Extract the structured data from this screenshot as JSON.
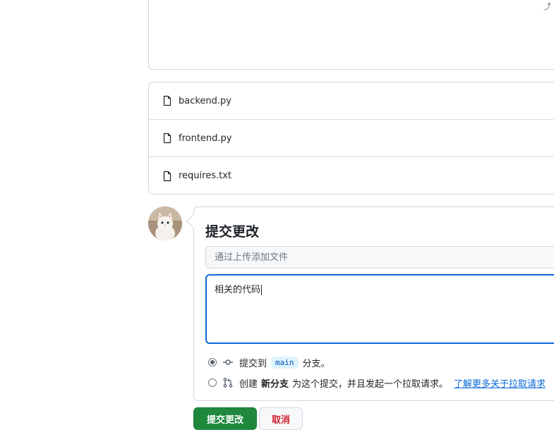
{
  "dropzone": {
    "corner_mark": "⤴"
  },
  "files": [
    {
      "name": "backend.py"
    },
    {
      "name": "frontend.py"
    },
    {
      "name": "requires.txt"
    }
  ],
  "commit": {
    "title": "提交更改",
    "summary_placeholder": "通过上传添加文件",
    "summary_value": "",
    "description": "相关的代码",
    "option_direct": {
      "prefix": "提交到",
      "branch": "main",
      "suffix": "分支。",
      "selected": true
    },
    "option_new_branch": {
      "prefix": "创建",
      "bold": "新分支",
      "suffix": "为这个提交，并且发起一个拉取请求。",
      "link": "了解更多关于拉取请求",
      "selected": false
    }
  },
  "buttons": {
    "commit": "提交更改",
    "cancel": "取消"
  },
  "colors": {
    "primary_button": "#1f883d",
    "cancel_text": "#cf222e",
    "focus_border": "#0969da",
    "link": "#0969da"
  }
}
